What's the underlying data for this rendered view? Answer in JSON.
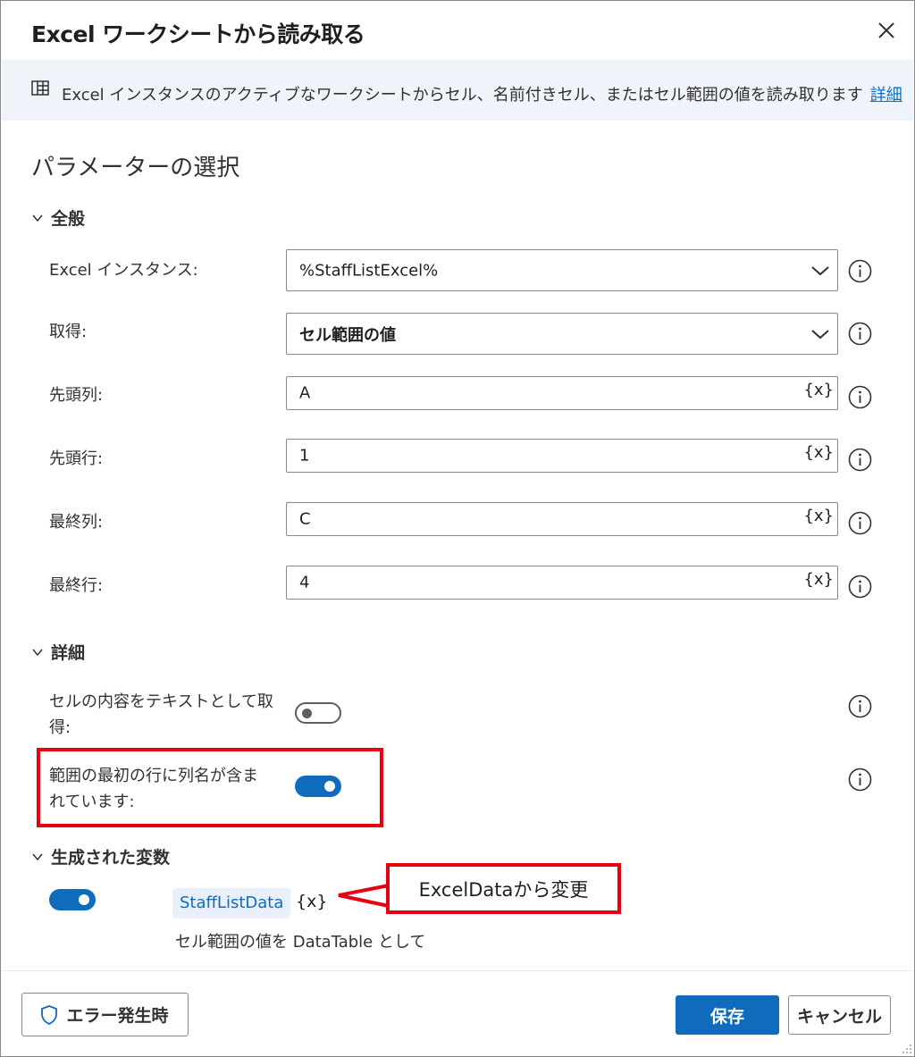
{
  "dialog": {
    "title": "Excel ワークシートから読み取る",
    "close_icon": "close-icon"
  },
  "info": {
    "icon": "excel-sheet-icon",
    "text": "Excel インスタンスのアクティブなワークシートからセル、名前付きセル、またはセル範囲の値を読み取ります",
    "link": "詳細"
  },
  "section_title": "パラメーターの選択",
  "general": {
    "title": "全般",
    "fields": {
      "instance": {
        "label": "Excel インスタンス:",
        "value": "%StaffListExcel%"
      },
      "retrieve": {
        "label": "取得:",
        "value": "セル範囲の値"
      },
      "start_col": {
        "label": "先頭列:",
        "value": "A"
      },
      "start_row": {
        "label": "先頭行:",
        "value": "1"
      },
      "end_col": {
        "label": "最終列:",
        "value": "C"
      },
      "end_row": {
        "label": "最終行:",
        "value": "4"
      }
    },
    "var_button": "{x}"
  },
  "details": {
    "title": "詳細",
    "as_text": {
      "label_line1": "セルの内容をテキストとして取",
      "label_line2": "得:",
      "enabled": false
    },
    "header_row": {
      "label_line1": "範囲の最初の行に列名が含ま",
      "label_line2": "れています:",
      "enabled": true
    }
  },
  "variables": {
    "title": "生成された変数",
    "enabled": true,
    "name": "StaffListData",
    "var_button": "{x}",
    "description": "セル範囲の値を DataTable として"
  },
  "annotation": {
    "text": "ExcelDataから変更",
    "color": "#e60012"
  },
  "footer": {
    "on_error": "エラー発生時",
    "save": "保存",
    "cancel": "キャンセル"
  },
  "colors": {
    "accent": "#0f6cbd",
    "info_bg": "#eff4fb"
  }
}
